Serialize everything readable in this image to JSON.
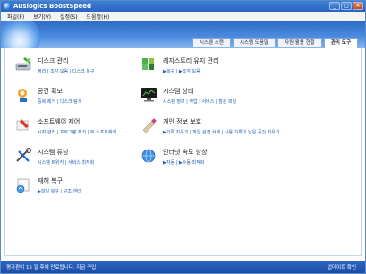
{
  "window": {
    "title": "Auslogics BoostSpeed",
    "minimize": "_",
    "maximize": "□",
    "close": "✕"
  },
  "menu": [
    "파일(F)",
    "보기(V)",
    "설정(S)",
    "도움말(H)"
  ],
  "tabs": [
    "시스템 스캔",
    "시스템 도움말",
    "자원 활용 현황",
    "관리 도구"
  ],
  "active_tab_index": 3,
  "tools": [
    {
      "title": "디스크 관리",
      "links": "정리 | 조각 모음 | 디스크 복구",
      "icon": "disk-cleanup-icon"
    },
    {
      "title": "레지스트리 유지 관리",
      "links": "▶복구 | ▶조각 모음",
      "icon": "registry-icon"
    },
    {
      "title": "공간 확보",
      "links": "중복 제거 | 디스크 탐색",
      "icon": "space-icon"
    },
    {
      "title": "시스템 상태",
      "links": "시스템 정보 | 작업 | 서비스 | 점검 파일",
      "icon": "monitor-icon"
    },
    {
      "title": "소프트웨어 제어",
      "links": "시작 관리 | 프로그램 제거 | 무 소프트웨어",
      "icon": "software-icon"
    },
    {
      "title": "개인 정보 보호",
      "links": "▶기록 지우기 | 파일 완전 삭제 | 사용 기록이 남은 공간 지우기",
      "icon": "privacy-icon"
    },
    {
      "title": "시스템 튜닝",
      "links": "시스템 트위커 | 서비스 최적화",
      "icon": "tuning-icon"
    },
    {
      "title": "인터넷 속도 향상",
      "links": "▶자동 | ▶수동 최적화",
      "icon": "internet-icon"
    },
    {
      "title": "재해 복구",
      "links": "▶파일 복구 | 구조 센터",
      "icon": "recovery-icon"
    }
  ],
  "status": {
    "left": "평가판이 15 일 후에 만료됩니다. 지금 구입",
    "right": "업데이트 확인"
  },
  "colors": {
    "accent": "#2a64c0",
    "link": "#1f5fb5"
  }
}
